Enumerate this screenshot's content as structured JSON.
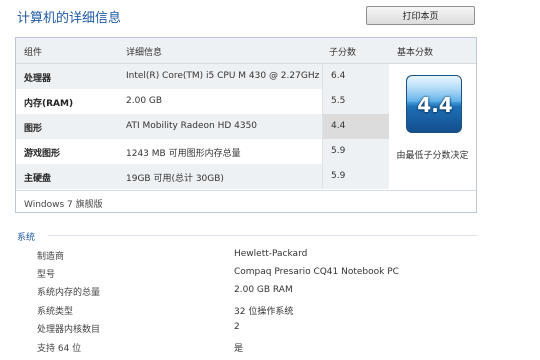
{
  "title": "计算机的详细信息",
  "print_button": "打印本页",
  "table": {
    "headers": {
      "component": "组件",
      "details": "详细信息",
      "subscore": "子分数",
      "base_score": "基本分数"
    },
    "rows": [
      {
        "component": "处理器",
        "details": "Intel(R) Core(TM) i5 CPU M 430 @ 2.27GHz",
        "subscore": "6.4"
      },
      {
        "component": "内存(RAM)",
        "details": "2.00 GB",
        "subscore": "5.5"
      },
      {
        "component": "图形",
        "details": "ATI Mobility Radeon HD 4350",
        "subscore": "4.4"
      },
      {
        "component": "游戏图形",
        "details": "1243 MB 可用图形内存总量",
        "subscore": "5.9"
      },
      {
        "component": "主硬盘",
        "details": "19GB 可用(总计 30GB)",
        "subscore": "5.9"
      }
    ],
    "base_score": "4.4",
    "base_score_note": "由最低子分数决定",
    "edition": "Windows 7 旗舰版"
  },
  "system": {
    "heading": "系统",
    "items": [
      {
        "label": "制造商",
        "value": "Hewlett-Packard"
      },
      {
        "label": "型号",
        "value": "Compaq Presario CQ41 Notebook PC"
      },
      {
        "label": "系统内存的总量",
        "value": "2.00 GB RAM"
      },
      {
        "label": "系统类型",
        "value": "32 位操作系统"
      },
      {
        "label": "处理器内核数目",
        "value": "2"
      },
      {
        "label": "支持 64 位",
        "value": "是"
      }
    ]
  },
  "colors": {
    "title": "#1e5aa8",
    "badge": "#1e6fb5"
  }
}
